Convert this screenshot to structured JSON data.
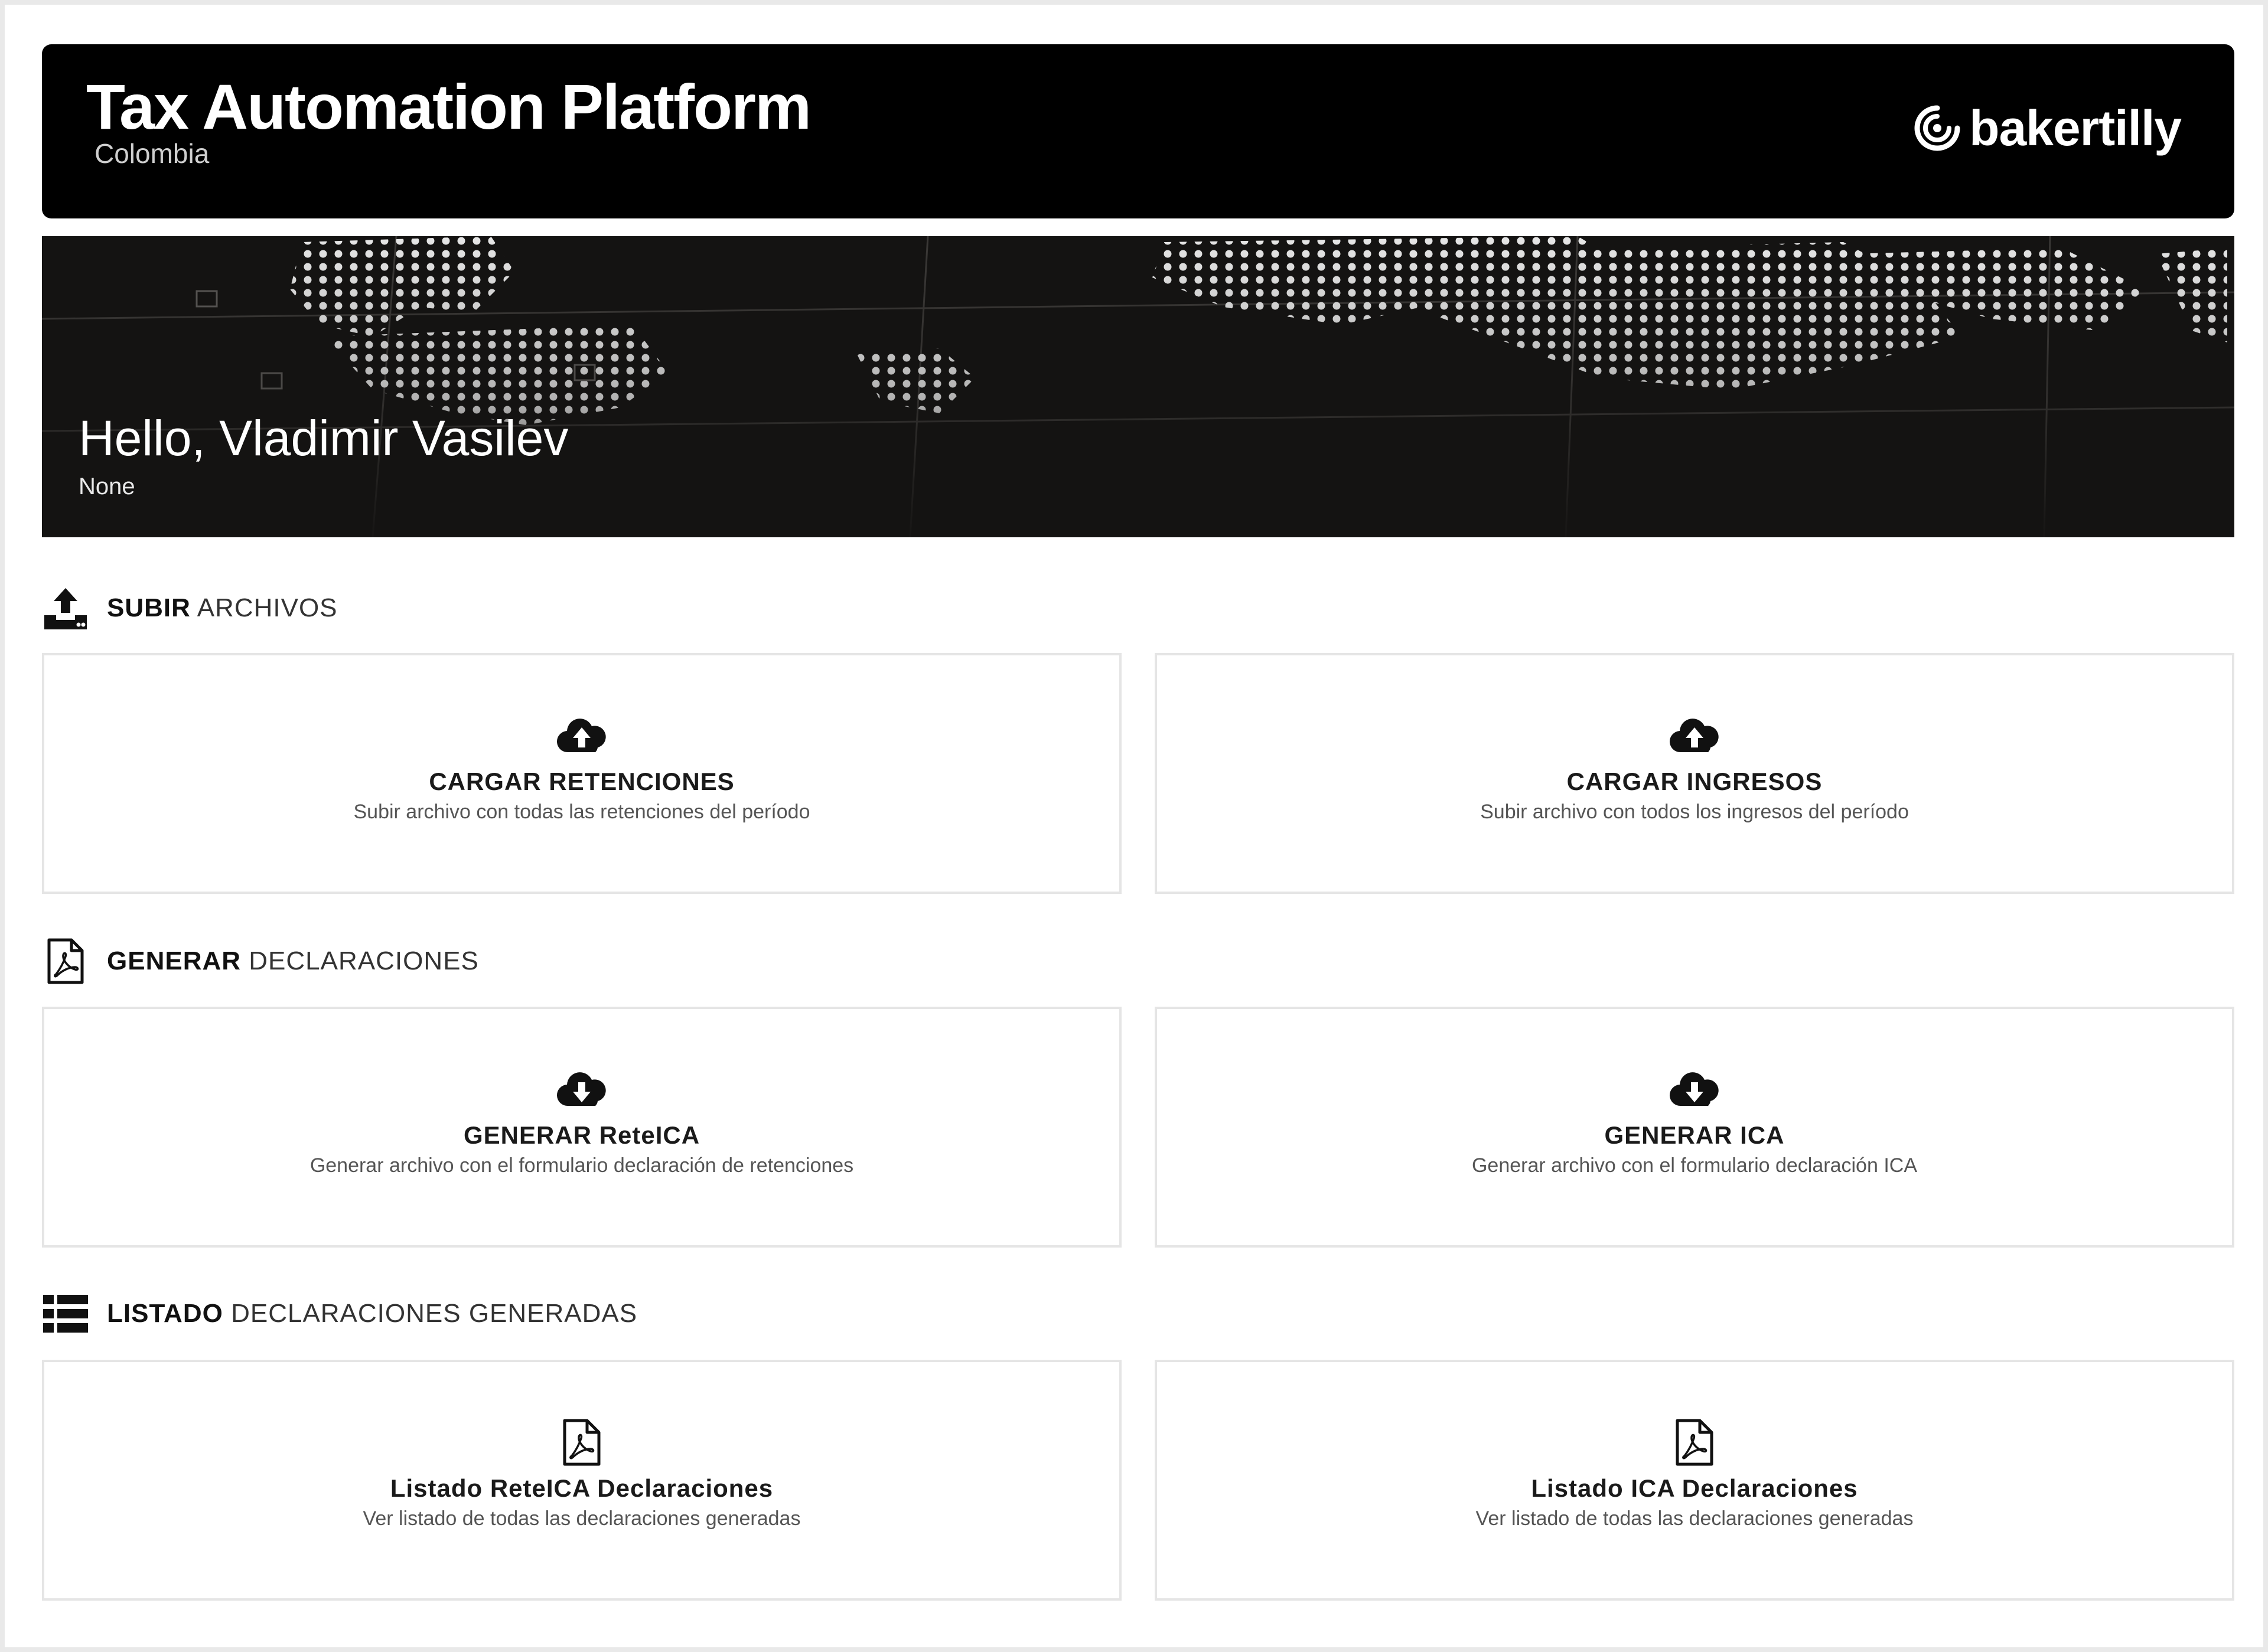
{
  "header": {
    "title": "Tax Automation Platform",
    "subtitle": "Colombia",
    "brand": "bakertilly"
  },
  "hero": {
    "greeting": "Hello, Vladimir Vasilev",
    "role": "None"
  },
  "sections": [
    {
      "title_bold": "SUBIR",
      "title_rest": " ARCHIVOS",
      "icon": "upload-icon",
      "cards": [
        {
          "icon": "cloud-upload-icon",
          "title": "CARGAR RETENCIONES",
          "description": "Subir archivo con todas las retenciones del período"
        },
        {
          "icon": "cloud-upload-icon",
          "title": "CARGAR INGRESOS",
          "description": "Subir archivo con todos los ingresos del período"
        }
      ]
    },
    {
      "title_bold": "GENERAR",
      "title_rest": " DECLARACIONES",
      "icon": "pdf-file-icon",
      "cards": [
        {
          "icon": "cloud-download-icon",
          "title": "GENERAR ReteICA",
          "description": "Generar archivo con el formulario declaración de retenciones"
        },
        {
          "icon": "cloud-download-icon",
          "title": "GENERAR ICA",
          "description": "Generar archivo con el formulario declaración ICA"
        }
      ]
    },
    {
      "title_bold": "LISTADO",
      "title_rest": " DECLARACIONES GENERADAS",
      "icon": "list-icon",
      "cards": [
        {
          "icon": "pdf-file-icon",
          "title": "Listado ReteICA Declaraciones",
          "description": "Ver listado de todas las declaraciones generadas"
        },
        {
          "icon": "pdf-file-icon",
          "title": "Listado ICA Declaraciones",
          "description": "Ver listado de todas las declaraciones generadas"
        }
      ]
    }
  ]
}
